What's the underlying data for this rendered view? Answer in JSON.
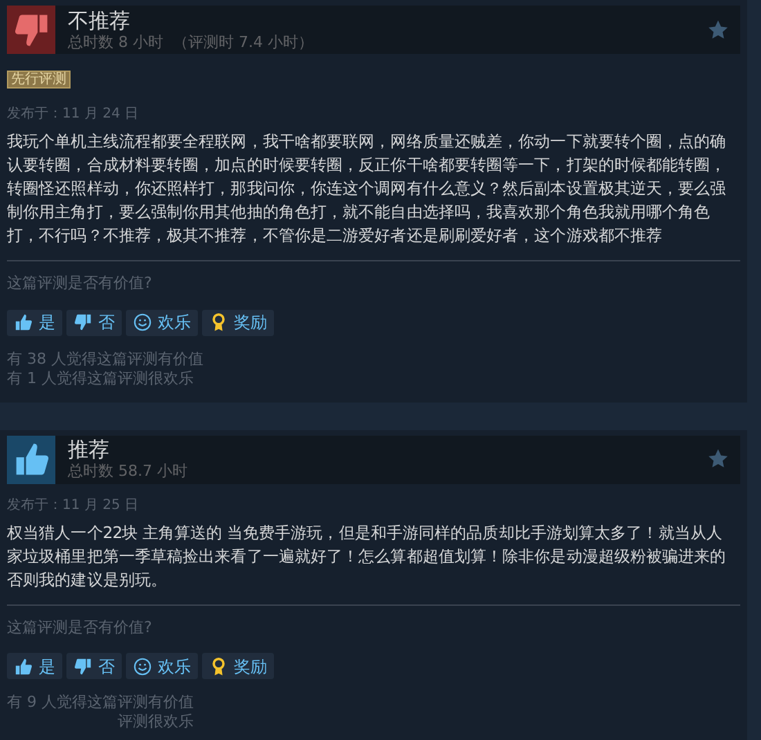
{
  "reviews": [
    {
      "verdict": "不推荐",
      "kind": "negative",
      "hours": "总时数 8 小时",
      "hours_at_review": "（评测时 7.4 小时）",
      "badge": "先行评测",
      "posted": "发布于：11 月 24 日",
      "body": "我玩个单机主线流程都要全程联网，我干啥都要联网，网络质量还贼差，你动一下就要转个圈，点的确认要转圈，合成材料要转圈，加点的时候要转圈，反正你干啥都要转圈等一下，打架的时候都能转圈，转圈怪还照样动，你还照样打，那我问你，你连这个调网有什么意义？然后副本设置极其逆天，要么强制你用主角打，要么强制你用其他抽的角色打，就不能自由选择吗，我喜欢那个角色我就用哪个角色打，不行吗？不推荐，极其不推荐，不管你是二游爱好者还是刷刷爱好者，这个游戏都不推荐",
      "question": "这篇评测是否有价值?",
      "buttons": [
        {
          "kind": "yes",
          "label": "是"
        },
        {
          "kind": "no",
          "label": "否"
        },
        {
          "kind": "funny",
          "label": "欢乐"
        },
        {
          "kind": "award",
          "label": "奖励"
        }
      ],
      "stats": [
        "有 38 人觉得这篇评测有价值",
        "有 1 人觉得这篇评测很欢乐"
      ]
    },
    {
      "verdict": "推荐",
      "kind": "positive",
      "hours": "总时数 58.7 小时",
      "posted": "发布于：11 月 25 日",
      "body": "权当猎人一个22块 主角算送的 当免费手游玩，但是和手游同样的品质却比手游划算太多了！就当从人家垃圾桶里把第一季草稿捡出来看了一遍就好了！怎么算都超值划算！除非你是动漫超级粉被骗进来的否则我的建议是别玩。",
      "question": "这篇评测是否有价值?",
      "buttons": [
        {
          "kind": "yes",
          "label": "是"
        },
        {
          "kind": "no",
          "label": "否"
        },
        {
          "kind": "funny",
          "label": "欢乐"
        },
        {
          "kind": "award",
          "label": "奖励"
        }
      ],
      "stats": [
        "有 9 人觉得这篇评测有价值",
        "评测很欢乐"
      ]
    }
  ]
}
